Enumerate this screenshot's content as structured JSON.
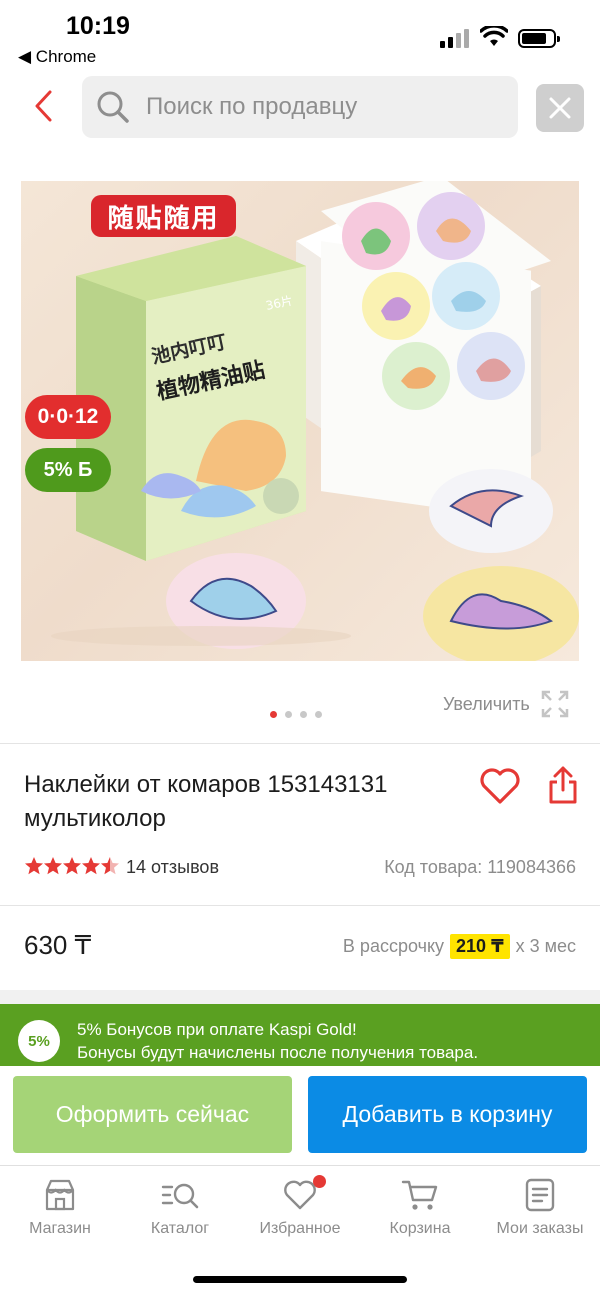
{
  "status_bar": {
    "time": "10:19",
    "back_app": "◀ Chrome"
  },
  "search": {
    "placeholder": "Поиск по продавцу"
  },
  "product_image": {
    "promo_tag": "随贴随用",
    "credit_badge": "0·0·12",
    "bonus_badge": "5% Б",
    "box_brand": "池内叮叮",
    "box_title": "植物精油贴",
    "box_count": "36片",
    "slides_total": 4,
    "active_slide": 1
  },
  "zoom_label": "Увеличить",
  "product": {
    "title": "Наклейки от комаров 153143131 мультиколор",
    "rating": 4.5,
    "reviews": "14 отзывов",
    "sku": "Код товара: 119084366",
    "price": "630 ₸",
    "installment_prefix": "В рассрочку",
    "installment_amount": "210 ₸",
    "installment_suffix": "x 3 мес"
  },
  "bonus": {
    "badge": "5%",
    "line1": "5% Бонусов при оплате Kaspi Gold!",
    "line2": "Бонусы будут начислены после получения товара."
  },
  "actions": {
    "buy_now": "Оформить сейчас",
    "add_to_cart": "Добавить в корзину"
  },
  "tabs": [
    {
      "label": "Магазин",
      "icon": "shop-icon"
    },
    {
      "label": "Каталог",
      "icon": "catalog-icon"
    },
    {
      "label": "Избранное",
      "icon": "heart-icon",
      "has_badge": true
    },
    {
      "label": "Корзина",
      "icon": "cart-icon"
    },
    {
      "label": "Мои заказы",
      "icon": "orders-icon"
    }
  ],
  "colors": {
    "accent_red": "#e53935",
    "kaspi_green": "#5aa021",
    "kaspi_blue": "#0b8be5",
    "highlight_yellow": "#ffe400"
  }
}
